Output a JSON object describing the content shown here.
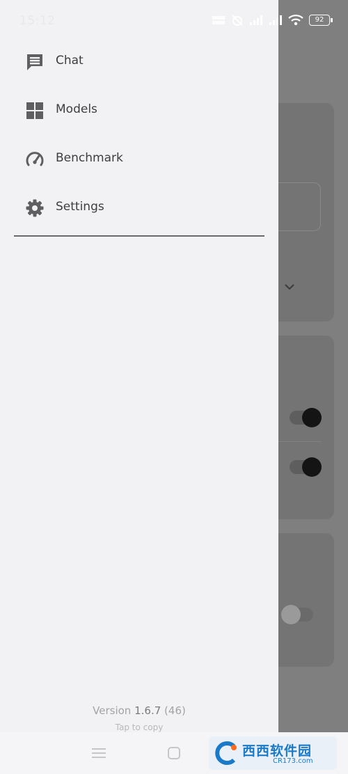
{
  "status_bar": {
    "time": "15:12",
    "battery": "92"
  },
  "drawer": {
    "items": [
      {
        "label": "Chat",
        "icon": "chat-icon"
      },
      {
        "label": "Models",
        "icon": "grid-icon"
      },
      {
        "label": "Benchmark",
        "icon": "speedometer-icon"
      },
      {
        "label": "Settings",
        "icon": "gear-icon"
      }
    ],
    "version_label": "Version",
    "version_number": "1.6.7",
    "build_number": "(46)",
    "copy_hint": "Tap to copy"
  },
  "background": {
    "switches": [
      {
        "state": "on"
      },
      {
        "state": "on"
      },
      {
        "state": "off"
      }
    ]
  },
  "watermark": {
    "main_text": "西西软件园",
    "sub_text": "CR173.com"
  },
  "colors": {
    "drawer_bg": "#f2f2f4",
    "scrim": "#7f7f7f",
    "icon_gray": "#5f5f62",
    "text": "#3e3e40",
    "watermark_blue": "#1b7ac8"
  }
}
